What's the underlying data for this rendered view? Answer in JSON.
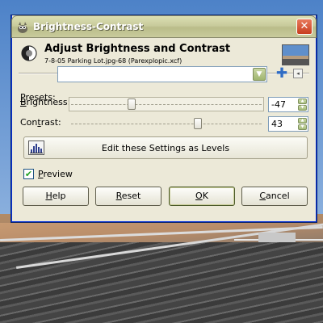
{
  "window": {
    "title": "Brightness-Contrast",
    "close_glyph": "✕"
  },
  "header": {
    "title": "Adjust Brightness and Contrast",
    "subtitle": "7-8-05 Parking Lot.jpg-68 (Parexplopic.xcf)"
  },
  "presets": {
    "label_prefix": "",
    "label_underlined": "P",
    "label_rest": "resets:",
    "value": "",
    "add_glyph": "✚",
    "menu_glyph": "◂"
  },
  "brightness": {
    "label_prefix": "",
    "label_underlined": "B",
    "label_rest": "rightness:",
    "value": "-47",
    "min": -127,
    "max": 127
  },
  "contrast": {
    "label_prefix": "Con",
    "label_underlined": "t",
    "label_rest": "rast:",
    "value": "43",
    "min": -127,
    "max": 127
  },
  "levels_button": {
    "label": "Edit these Settings as Levels"
  },
  "preview": {
    "label_underlined": "P",
    "label_rest": "review",
    "checked": true,
    "check_glyph": "✔"
  },
  "buttons": {
    "help_u": "H",
    "help_rest": "elp",
    "reset_u": "R",
    "reset_rest": "eset",
    "ok_u": "O",
    "ok_rest": "K",
    "cancel_u": "C",
    "cancel_rest": "ancel"
  },
  "spinner_glyphs": {
    "up": "▲",
    "down": "▼"
  },
  "icons": {
    "app": "gimp-wilber-icon",
    "header": "brightness-contrast-icon",
    "thumbnail": "image-thumbnail",
    "levels": "levels-histogram-icon"
  }
}
